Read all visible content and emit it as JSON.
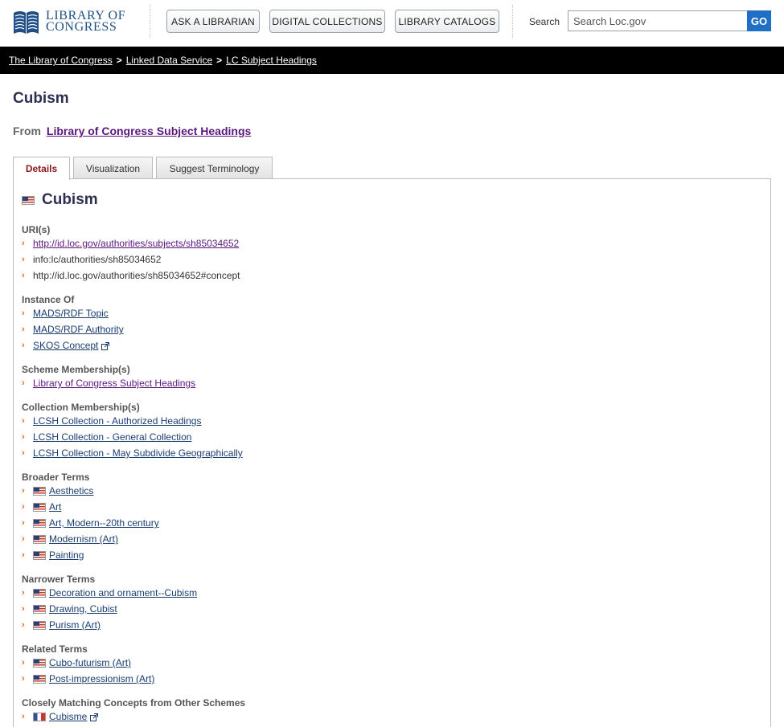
{
  "header": {
    "logo_line1": "LIBRARY OF",
    "logo_line2": "CONGRESS",
    "buttons": [
      "ASK A LIBRARIAN",
      "DIGITAL COLLECTIONS",
      "LIBRARY CATALOGS"
    ],
    "search_label": "Search",
    "search_placeholder": "Search Loc.gov",
    "go_label": "GO"
  },
  "breadcrumb": [
    "The Library of Congress",
    "Linked Data Service",
    "LC Subject Headings"
  ],
  "page": {
    "title": "Cubism",
    "from_label": "From",
    "from_link": "Library of Congress Subject Headings"
  },
  "tabs": [
    "Details",
    "Visualization",
    "Suggest Terminology"
  ],
  "concept": {
    "heading": "Cubism",
    "sections": {
      "uris": {
        "title": "URI(s)",
        "items": [
          "http://id.loc.gov/authorities/subjects/sh85034652",
          "info:lc/authorities/sh85034652",
          "http://id.loc.gov/authorities/sh85034652#concept"
        ]
      },
      "instance": {
        "title": "Instance Of",
        "items": [
          "MADS/RDF Topic",
          "MADS/RDF Authority",
          "SKOS Concept"
        ]
      },
      "scheme": {
        "title": "Scheme Membership(s)",
        "items": [
          "Library of Congress Subject Headings"
        ]
      },
      "collection": {
        "title": "Collection Membership(s)",
        "items": [
          "LCSH Collection - Authorized Headings",
          "LCSH Collection - General Collection",
          "LCSH Collection - May Subdivide Geographically"
        ]
      },
      "broader": {
        "title": "Broader Terms",
        "items": [
          "Aesthetics",
          "Art",
          "Art, Modern--20th century",
          "Modernism (Art)",
          "Painting"
        ]
      },
      "narrower": {
        "title": "Narrower Terms",
        "items": [
          "Decoration and ornament--Cubism",
          "Drawing, Cubist",
          "Purism (Art)"
        ]
      },
      "related": {
        "title": "Related Terms",
        "items": [
          "Cubo-futurism (Art)",
          "Post-impressionism (Art)"
        ]
      },
      "closely": {
        "title": "Closely Matching Concepts from Other Schemes",
        "items": [
          "Cubisme"
        ]
      }
    }
  },
  "colors": {
    "brand_blue": "#1f4f86",
    "go_button": "#1f6fc4",
    "link": "#1a3d6e",
    "visited_link": "#5c177d",
    "chevron": "#d9661a",
    "active_tab": "#8a1a1a"
  }
}
